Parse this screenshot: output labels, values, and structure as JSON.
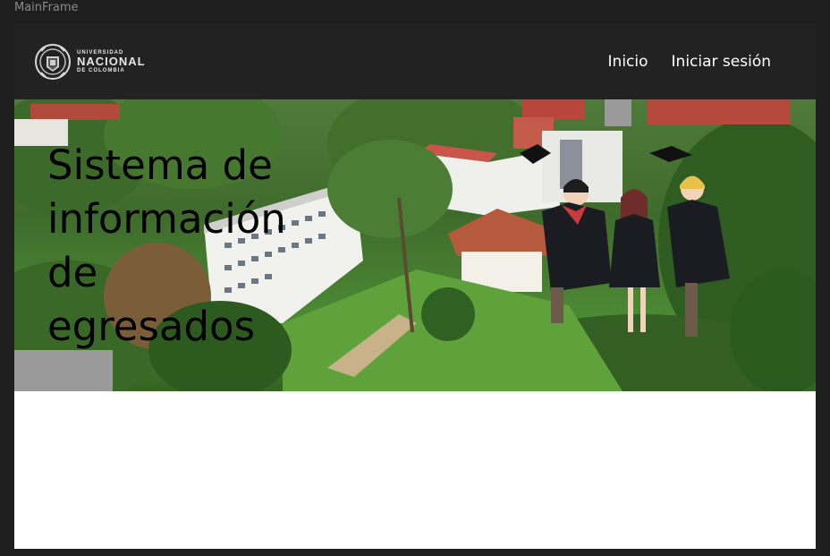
{
  "window": {
    "title": "MainFrame"
  },
  "navbar": {
    "logo": {
      "line1": "UNIVERSIDAD",
      "line2": "NACIONAL",
      "line3": "DE COLOMBIA"
    },
    "links": [
      "Inicio",
      "Iniciar sesión"
    ]
  },
  "hero": {
    "title": "Sistema de información de egresados"
  },
  "colors": {
    "window_bg": "#1e1e1e",
    "navbar_bg": "#222222",
    "content_bg": "#ffffff",
    "nav_text": "#ffffff",
    "title_text": "#000000"
  }
}
